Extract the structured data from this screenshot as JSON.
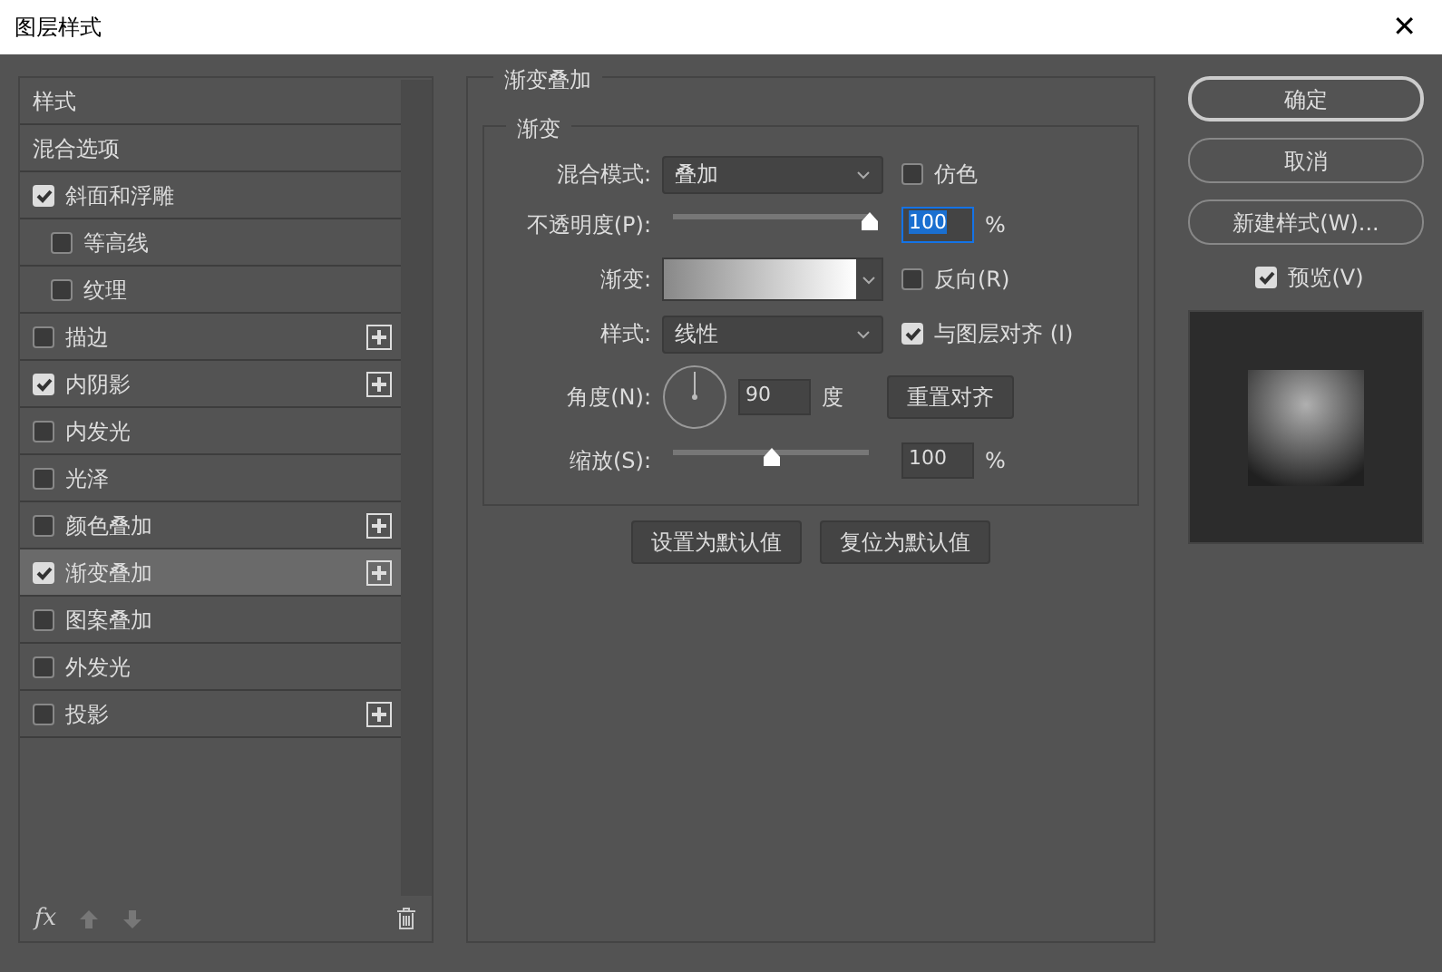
{
  "window": {
    "title": "图层样式",
    "close": "✕"
  },
  "sidebar": {
    "items": [
      {
        "kind": "header",
        "label": "样式",
        "selected": false
      },
      {
        "kind": "header",
        "label": "混合选项",
        "selected": false
      },
      {
        "kind": "check",
        "label": "斜面和浮雕",
        "checked": true,
        "plus": false,
        "selected": false,
        "children": [
          {
            "kind": "check",
            "label": "等高线",
            "checked": false,
            "plus": false,
            "selected": false
          },
          {
            "kind": "check",
            "label": "纹理",
            "checked": false,
            "plus": false,
            "selected": false
          }
        ]
      },
      {
        "kind": "check",
        "label": "描边",
        "checked": false,
        "plus": true,
        "selected": false
      },
      {
        "kind": "check",
        "label": "内阴影",
        "checked": true,
        "plus": true,
        "selected": false
      },
      {
        "kind": "check",
        "label": "内发光",
        "checked": false,
        "plus": false,
        "selected": false
      },
      {
        "kind": "check",
        "label": "光泽",
        "checked": false,
        "plus": false,
        "selected": false
      },
      {
        "kind": "check",
        "label": "颜色叠加",
        "checked": false,
        "plus": true,
        "selected": false
      },
      {
        "kind": "check",
        "label": "渐变叠加",
        "checked": true,
        "plus": true,
        "selected": true
      },
      {
        "kind": "check",
        "label": "图案叠加",
        "checked": false,
        "plus": false,
        "selected": false
      },
      {
        "kind": "check",
        "label": "外发光",
        "checked": false,
        "plus": false,
        "selected": false
      },
      {
        "kind": "check",
        "label": "投影",
        "checked": false,
        "plus": true,
        "selected": false
      }
    ],
    "footer": {
      "fx": "fx"
    }
  },
  "panel": {
    "title": "渐变叠加",
    "group": "渐变",
    "blend_mode": {
      "label": "混合模式:",
      "value": "叠加"
    },
    "dither": {
      "label": "仿色",
      "checked": false
    },
    "opacity": {
      "label": "不透明度(P):",
      "level": 1.0,
      "value": "100",
      "unit": "%"
    },
    "gradient": {
      "label": "渐变:"
    },
    "reverse": {
      "label": "反向(R)",
      "checked": false
    },
    "style": {
      "label": "样式:",
      "value": "线性"
    },
    "align": {
      "label": "与图层对齐 (I)",
      "checked": true
    },
    "angle": {
      "label": "角度(N):",
      "value": "90",
      "unit": "度",
      "reset": "重置对齐"
    },
    "scale": {
      "label": "缩放(S):",
      "level": 0.5,
      "value": "100",
      "unit": "%"
    },
    "buttons": [
      "设置为默认值",
      "复位为默认值"
    ]
  },
  "actions": {
    "buttons": [
      "确定",
      "取消",
      "新建样式(W)..."
    ],
    "preview": {
      "label": "预览(V)",
      "checked": true
    }
  }
}
